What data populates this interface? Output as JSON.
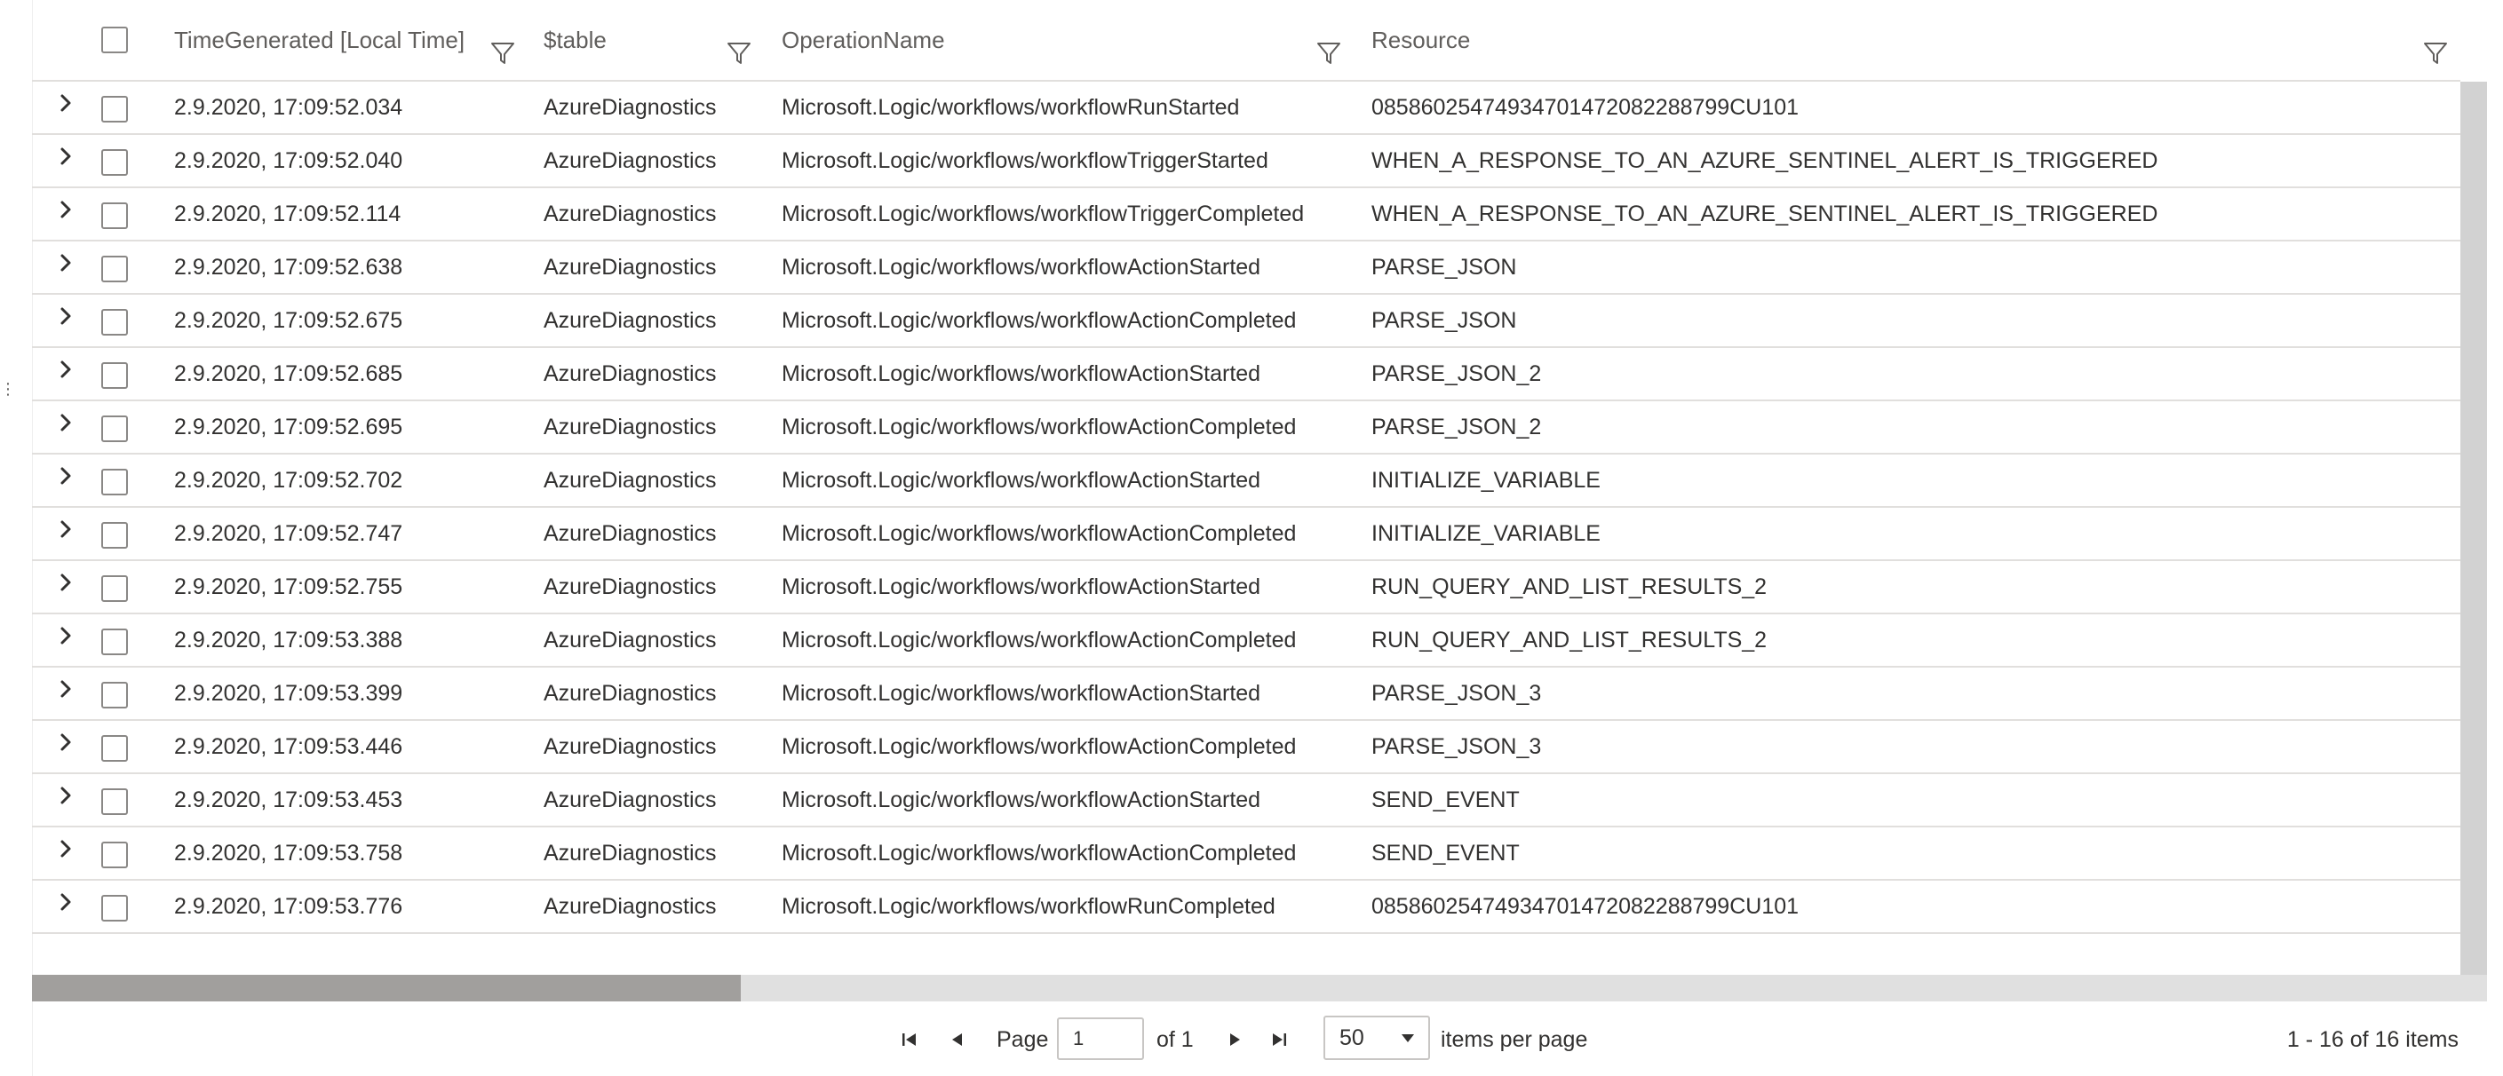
{
  "columns": {
    "time": "TimeGenerated [Local Time]",
    "table": "$table",
    "operation": "OperationName",
    "resource": "Resource"
  },
  "rows": [
    {
      "time": "2.9.2020, 17:09:52.034",
      "table": "AzureDiagnostics",
      "operation": "Microsoft.Logic/workflows/workflowRunStarted",
      "resource": "08586025474934701472082288799CU101"
    },
    {
      "time": "2.9.2020, 17:09:52.040",
      "table": "AzureDiagnostics",
      "operation": "Microsoft.Logic/workflows/workflowTriggerStarted",
      "resource": "WHEN_A_RESPONSE_TO_AN_AZURE_SENTINEL_ALERT_IS_TRIGGERED"
    },
    {
      "time": "2.9.2020, 17:09:52.114",
      "table": "AzureDiagnostics",
      "operation": "Microsoft.Logic/workflows/workflowTriggerCompleted",
      "resource": "WHEN_A_RESPONSE_TO_AN_AZURE_SENTINEL_ALERT_IS_TRIGGERED"
    },
    {
      "time": "2.9.2020, 17:09:52.638",
      "table": "AzureDiagnostics",
      "operation": "Microsoft.Logic/workflows/workflowActionStarted",
      "resource": "PARSE_JSON"
    },
    {
      "time": "2.9.2020, 17:09:52.675",
      "table": "AzureDiagnostics",
      "operation": "Microsoft.Logic/workflows/workflowActionCompleted",
      "resource": "PARSE_JSON"
    },
    {
      "time": "2.9.2020, 17:09:52.685",
      "table": "AzureDiagnostics",
      "operation": "Microsoft.Logic/workflows/workflowActionStarted",
      "resource": "PARSE_JSON_2"
    },
    {
      "time": "2.9.2020, 17:09:52.695",
      "table": "AzureDiagnostics",
      "operation": "Microsoft.Logic/workflows/workflowActionCompleted",
      "resource": "PARSE_JSON_2"
    },
    {
      "time": "2.9.2020, 17:09:52.702",
      "table": "AzureDiagnostics",
      "operation": "Microsoft.Logic/workflows/workflowActionStarted",
      "resource": "INITIALIZE_VARIABLE"
    },
    {
      "time": "2.9.2020, 17:09:52.747",
      "table": "AzureDiagnostics",
      "operation": "Microsoft.Logic/workflows/workflowActionCompleted",
      "resource": "INITIALIZE_VARIABLE"
    },
    {
      "time": "2.9.2020, 17:09:52.755",
      "table": "AzureDiagnostics",
      "operation": "Microsoft.Logic/workflows/workflowActionStarted",
      "resource": "RUN_QUERY_AND_LIST_RESULTS_2"
    },
    {
      "time": "2.9.2020, 17:09:53.388",
      "table": "AzureDiagnostics",
      "operation": "Microsoft.Logic/workflows/workflowActionCompleted",
      "resource": "RUN_QUERY_AND_LIST_RESULTS_2"
    },
    {
      "time": "2.9.2020, 17:09:53.399",
      "table": "AzureDiagnostics",
      "operation": "Microsoft.Logic/workflows/workflowActionStarted",
      "resource": "PARSE_JSON_3"
    },
    {
      "time": "2.9.2020, 17:09:53.446",
      "table": "AzureDiagnostics",
      "operation": "Microsoft.Logic/workflows/workflowActionCompleted",
      "resource": "PARSE_JSON_3"
    },
    {
      "time": "2.9.2020, 17:09:53.453",
      "table": "AzureDiagnostics",
      "operation": "Microsoft.Logic/workflows/workflowActionStarted",
      "resource": "SEND_EVENT"
    },
    {
      "time": "2.9.2020, 17:09:53.758",
      "table": "AzureDiagnostics",
      "operation": "Microsoft.Logic/workflows/workflowActionCompleted",
      "resource": "SEND_EVENT"
    },
    {
      "time": "2.9.2020, 17:09:53.776",
      "table": "AzureDiagnostics",
      "operation": "Microsoft.Logic/workflows/workflowRunCompleted",
      "resource": "08586025474934701472082288799CU101"
    }
  ],
  "pager": {
    "page_label": "Page",
    "page_value": "1",
    "of_label": "of 1",
    "page_size": "50",
    "items_per_page_label": "items per page",
    "count_label": "1 - 16 of 16 items"
  },
  "icons": {
    "filter": "filter-icon",
    "expand": "chevron-right-icon",
    "first": "first-page-icon",
    "prev": "previous-page-icon",
    "next": "next-page-icon",
    "last": "last-page-icon",
    "dropdown": "chevron-down-icon"
  },
  "colors": {
    "text": "#323130",
    "header_text": "#605e5c",
    "grid_line": "#e1dfdd",
    "scroll_track": "#e0e0e0",
    "scroll_thumb": "#a19f9d"
  }
}
